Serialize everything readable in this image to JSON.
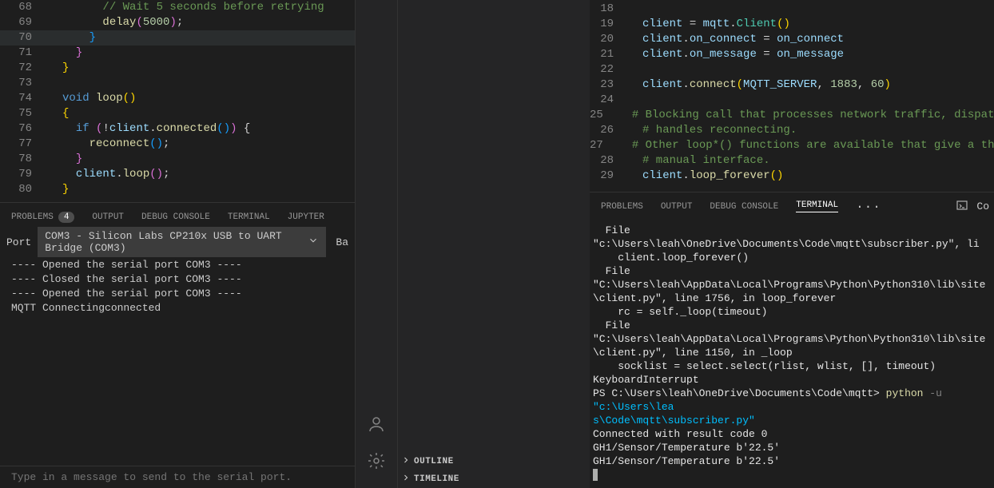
{
  "left_editor": {
    "lines": [
      {
        "n": 68,
        "segs": [
          {
            "t": "      ",
            "c": "pn"
          },
          {
            "t": "// Wait 5 seconds before retrying",
            "c": "cm"
          }
        ]
      },
      {
        "n": 69,
        "segs": [
          {
            "t": "      ",
            "c": "pn"
          },
          {
            "t": "delay",
            "c": "fn"
          },
          {
            "t": "(",
            "c": "br2"
          },
          {
            "t": "5000",
            "c": "num"
          },
          {
            "t": ")",
            "c": "br2"
          },
          {
            "t": ";",
            "c": "pn"
          }
        ]
      },
      {
        "n": 70,
        "hl": true,
        "segs": [
          {
            "t": "    ",
            "c": "pn"
          },
          {
            "t": "}",
            "c": "br3"
          }
        ]
      },
      {
        "n": 71,
        "segs": [
          {
            "t": "  ",
            "c": "pn"
          },
          {
            "t": "}",
            "c": "br2"
          }
        ]
      },
      {
        "n": 72,
        "segs": [
          {
            "t": "}",
            "c": "br"
          }
        ]
      },
      {
        "n": 73,
        "segs": [
          {
            "t": "",
            "c": "pn"
          }
        ]
      },
      {
        "n": 74,
        "segs": [
          {
            "t": "void",
            "c": "kw"
          },
          {
            "t": " ",
            "c": "pn"
          },
          {
            "t": "loop",
            "c": "fn"
          },
          {
            "t": "()",
            "c": "br"
          }
        ]
      },
      {
        "n": 75,
        "segs": [
          {
            "t": "{",
            "c": "br"
          }
        ]
      },
      {
        "n": 76,
        "segs": [
          {
            "t": "  ",
            "c": "pn"
          },
          {
            "t": "if",
            "c": "kw"
          },
          {
            "t": " ",
            "c": "pn"
          },
          {
            "t": "(",
            "c": "br2"
          },
          {
            "t": "!",
            "c": "pn"
          },
          {
            "t": "client",
            "c": "id"
          },
          {
            "t": ".",
            "c": "pn"
          },
          {
            "t": "connected",
            "c": "fn"
          },
          {
            "t": "()",
            "c": "br3"
          },
          {
            "t": ")",
            "c": "br2"
          },
          {
            "t": " {",
            "c": "pn"
          }
        ]
      },
      {
        "n": 77,
        "segs": [
          {
            "t": "    ",
            "c": "pn"
          },
          {
            "t": "reconnect",
            "c": "fn"
          },
          {
            "t": "()",
            "c": "br3"
          },
          {
            "t": ";",
            "c": "pn"
          }
        ]
      },
      {
        "n": 78,
        "segs": [
          {
            "t": "  ",
            "c": "pn"
          },
          {
            "t": "}",
            "c": "br2"
          }
        ]
      },
      {
        "n": 79,
        "segs": [
          {
            "t": "  ",
            "c": "pn"
          },
          {
            "t": "client",
            "c": "id"
          },
          {
            "t": ".",
            "c": "pn"
          },
          {
            "t": "loop",
            "c": "fn"
          },
          {
            "t": "()",
            "c": "br2"
          },
          {
            "t": ";",
            "c": "pn"
          }
        ]
      },
      {
        "n": 80,
        "segs": [
          {
            "t": "}",
            "c": "br"
          }
        ]
      }
    ]
  },
  "right_editor": {
    "lines": [
      {
        "n": 18,
        "segs": [
          {
            "t": "",
            "c": "pn"
          }
        ]
      },
      {
        "n": 19,
        "segs": [
          {
            "t": "client",
            "c": "id"
          },
          {
            "t": " = ",
            "c": "pn"
          },
          {
            "t": "mqtt",
            "c": "id"
          },
          {
            "t": ".",
            "c": "pn"
          },
          {
            "t": "Client",
            "c": "ty"
          },
          {
            "t": "()",
            "c": "br"
          }
        ]
      },
      {
        "n": 20,
        "segs": [
          {
            "t": "client",
            "c": "id"
          },
          {
            "t": ".",
            "c": "pn"
          },
          {
            "t": "on_connect",
            "c": "id"
          },
          {
            "t": " = ",
            "c": "pn"
          },
          {
            "t": "on_connect",
            "c": "id"
          }
        ]
      },
      {
        "n": 21,
        "segs": [
          {
            "t": "client",
            "c": "id"
          },
          {
            "t": ".",
            "c": "pn"
          },
          {
            "t": "on_message",
            "c": "id"
          },
          {
            "t": " = ",
            "c": "pn"
          },
          {
            "t": "on_message",
            "c": "id"
          }
        ]
      },
      {
        "n": 22,
        "segs": [
          {
            "t": "",
            "c": "pn"
          }
        ]
      },
      {
        "n": 23,
        "segs": [
          {
            "t": "client",
            "c": "id"
          },
          {
            "t": ".",
            "c": "pn"
          },
          {
            "t": "connect",
            "c": "fn"
          },
          {
            "t": "(",
            "c": "br"
          },
          {
            "t": "MQTT_SERVER",
            "c": "id"
          },
          {
            "t": ", ",
            "c": "pn"
          },
          {
            "t": "1883",
            "c": "num"
          },
          {
            "t": ", ",
            "c": "pn"
          },
          {
            "t": "60",
            "c": "num"
          },
          {
            "t": ")",
            "c": "br"
          }
        ]
      },
      {
        "n": 24,
        "segs": [
          {
            "t": "",
            "c": "pn"
          }
        ]
      },
      {
        "n": 25,
        "segs": [
          {
            "t": "# Blocking call that processes network traffic, dispatche",
            "c": "cm"
          }
        ]
      },
      {
        "n": 26,
        "segs": [
          {
            "t": "# handles reconnecting.",
            "c": "cm"
          }
        ]
      },
      {
        "n": 27,
        "segs": [
          {
            "t": "# Other loop*() functions are available that give a threa",
            "c": "cm"
          }
        ]
      },
      {
        "n": 28,
        "segs": [
          {
            "t": "# manual interface.",
            "c": "cm"
          }
        ]
      },
      {
        "n": 29,
        "segs": [
          {
            "t": "client",
            "c": "id"
          },
          {
            "t": ".",
            "c": "pn"
          },
          {
            "t": "loop_forever",
            "c": "fn"
          },
          {
            "t": "()",
            "c": "br"
          }
        ]
      }
    ]
  },
  "left_panel": {
    "tabs": {
      "problems": "PROBLEMS",
      "problems_badge": "4",
      "output": "OUTPUT",
      "debug": "DEBUG CONSOLE",
      "terminal": "TERMINAL",
      "jupyter": "JUPYTER"
    },
    "port_label": "Port",
    "port_value": "COM3 - Silicon Labs CP210x USB to UART Bridge (COM3)",
    "baud_label": "Ba",
    "output_lines": [
      "---- Opened the serial port COM3 ----",
      "---- Closed the serial port COM3 ----",
      "---- Opened the serial port COM3 ----",
      "MQTT Connectingconnected"
    ],
    "msg_placeholder": "Type in a message to send to the serial port."
  },
  "right_panel": {
    "tabs": {
      "problems": "PROBLEMS",
      "output": "OUTPUT",
      "debug": "DEBUG CONSOLE",
      "terminal": "TERMINAL"
    },
    "right_label": "Co",
    "lines": [
      {
        "segs": [
          {
            "t": "  File ",
            "c": "p-white"
          },
          {
            "t": "\"c:\\Users\\leah\\OneDrive\\Documents\\Code\\mqtt\\subscriber.py\"",
            "c": "p-white"
          },
          {
            "t": ", li",
            "c": "p-white"
          }
        ]
      },
      {
        "segs": [
          {
            "t": "    client.loop_forever()",
            "c": "p-white"
          }
        ]
      },
      {
        "segs": [
          {
            "t": "  File ",
            "c": "p-white"
          },
          {
            "t": "\"C:\\Users\\leah\\AppData\\Local\\Programs\\Python\\Python310\\lib\\site",
            "c": "p-white"
          }
        ]
      },
      {
        "segs": [
          {
            "t": "\\client.py\", line 1756, in loop_forever",
            "c": "p-white"
          }
        ]
      },
      {
        "segs": [
          {
            "t": "    rc = self._loop(timeout)",
            "c": "p-white"
          }
        ]
      },
      {
        "segs": [
          {
            "t": "  File ",
            "c": "p-white"
          },
          {
            "t": "\"C:\\Users\\leah\\AppData\\Local\\Programs\\Python\\Python310\\lib\\site",
            "c": "p-white"
          }
        ]
      },
      {
        "segs": [
          {
            "t": "\\client.py\", line 1150, in _loop",
            "c": "p-white"
          }
        ]
      },
      {
        "segs": [
          {
            "t": "    socklist = select.select(rlist, wlist, [], timeout)",
            "c": "p-white"
          }
        ]
      },
      {
        "segs": [
          {
            "t": "KeyboardInterrupt",
            "c": "p-white"
          }
        ]
      },
      {
        "segs": [
          {
            "t": "PS C:\\Users\\leah\\OneDrive\\Documents\\Code\\mqtt> ",
            "c": "p-white"
          },
          {
            "t": "python",
            "c": "p-yellow"
          },
          {
            "t": " ",
            "c": "p-white"
          },
          {
            "t": "-u",
            "c": "p-gray"
          },
          {
            "t": " ",
            "c": "p-white"
          },
          {
            "t": "\"c:\\Users\\lea",
            "c": "p-cyan"
          }
        ]
      },
      {
        "segs": [
          {
            "t": "s\\Code\\mqtt\\subscriber.py\"",
            "c": "p-cyan"
          }
        ]
      },
      {
        "segs": [
          {
            "t": "Connected with result code 0",
            "c": "p-white"
          }
        ]
      },
      {
        "segs": [
          {
            "t": "GH1/Sensor/Temperature b'22.5'",
            "c": "p-white"
          }
        ]
      },
      {
        "segs": [
          {
            "t": "GH1/Sensor/Temperature b'22.5'",
            "c": "p-white"
          }
        ]
      }
    ]
  },
  "outline": {
    "outline_label": "OUTLINE",
    "timeline_label": "TIMELINE"
  }
}
